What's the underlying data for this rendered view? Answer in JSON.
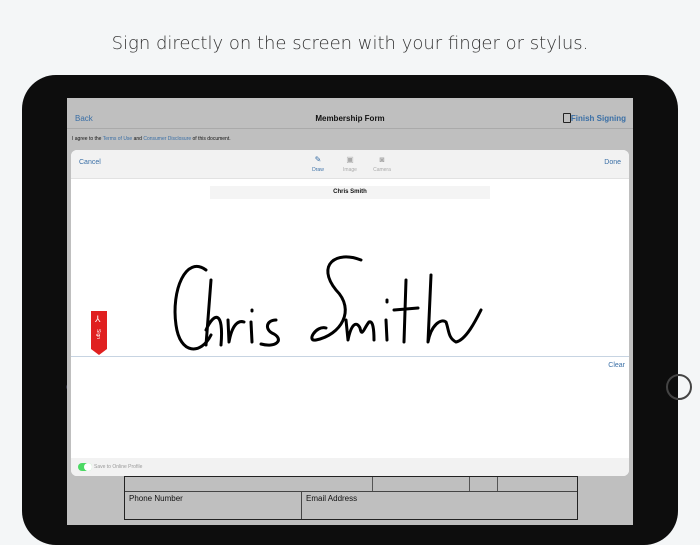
{
  "headline": "Sign directly on the screen with your finger or stylus.",
  "nav": {
    "back": "Back",
    "title": "Membership Form",
    "finish": "Finish Signing"
  },
  "agree": {
    "pre": "I agree to the ",
    "terms": "Terms of Use",
    "mid": " and ",
    "disclosure": "Consumer Disclosure",
    "post": " of this document."
  },
  "form": {
    "phone": "Phone Number",
    "email": "Email Address"
  },
  "modal": {
    "cancel": "Cancel",
    "done": "Done",
    "tools": [
      {
        "label": "Draw",
        "icon": "pen-icon"
      },
      {
        "label": "Image",
        "icon": "image-icon"
      },
      {
        "label": "Camera",
        "icon": "camera-icon"
      }
    ],
    "name": "Chris Smith",
    "signature": "Chris Smith",
    "clear": "Clear",
    "save_label": "Save to Online Profile",
    "save_on": true
  },
  "tag": {
    "label": "Sign"
  },
  "colors": {
    "link": "#3a6fa6",
    "tag": "#e02020",
    "toggle": "#4cd964"
  }
}
